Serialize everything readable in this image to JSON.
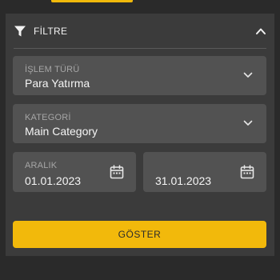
{
  "filter": {
    "title": "FİLTRE",
    "icons": {
      "filter": "filter-funnel-icon",
      "collapse": "chevron-up-icon",
      "dropdown": "chevron-down-icon",
      "calendar": "calendar-icon"
    },
    "transaction_type": {
      "label": "İŞLEM TÜRÜ",
      "value": "Para Yatırma"
    },
    "category": {
      "label": "KATEGORİ",
      "value": "Main Category"
    },
    "range": {
      "label": "ARALIK",
      "start": "01.01.2023",
      "end": "31.01.2023"
    },
    "show_button": "GÖSTER"
  },
  "colors": {
    "accent": "#f2b90b",
    "panel": "#3b3b3b",
    "field": "#525252",
    "background": "#2a2a2a"
  }
}
